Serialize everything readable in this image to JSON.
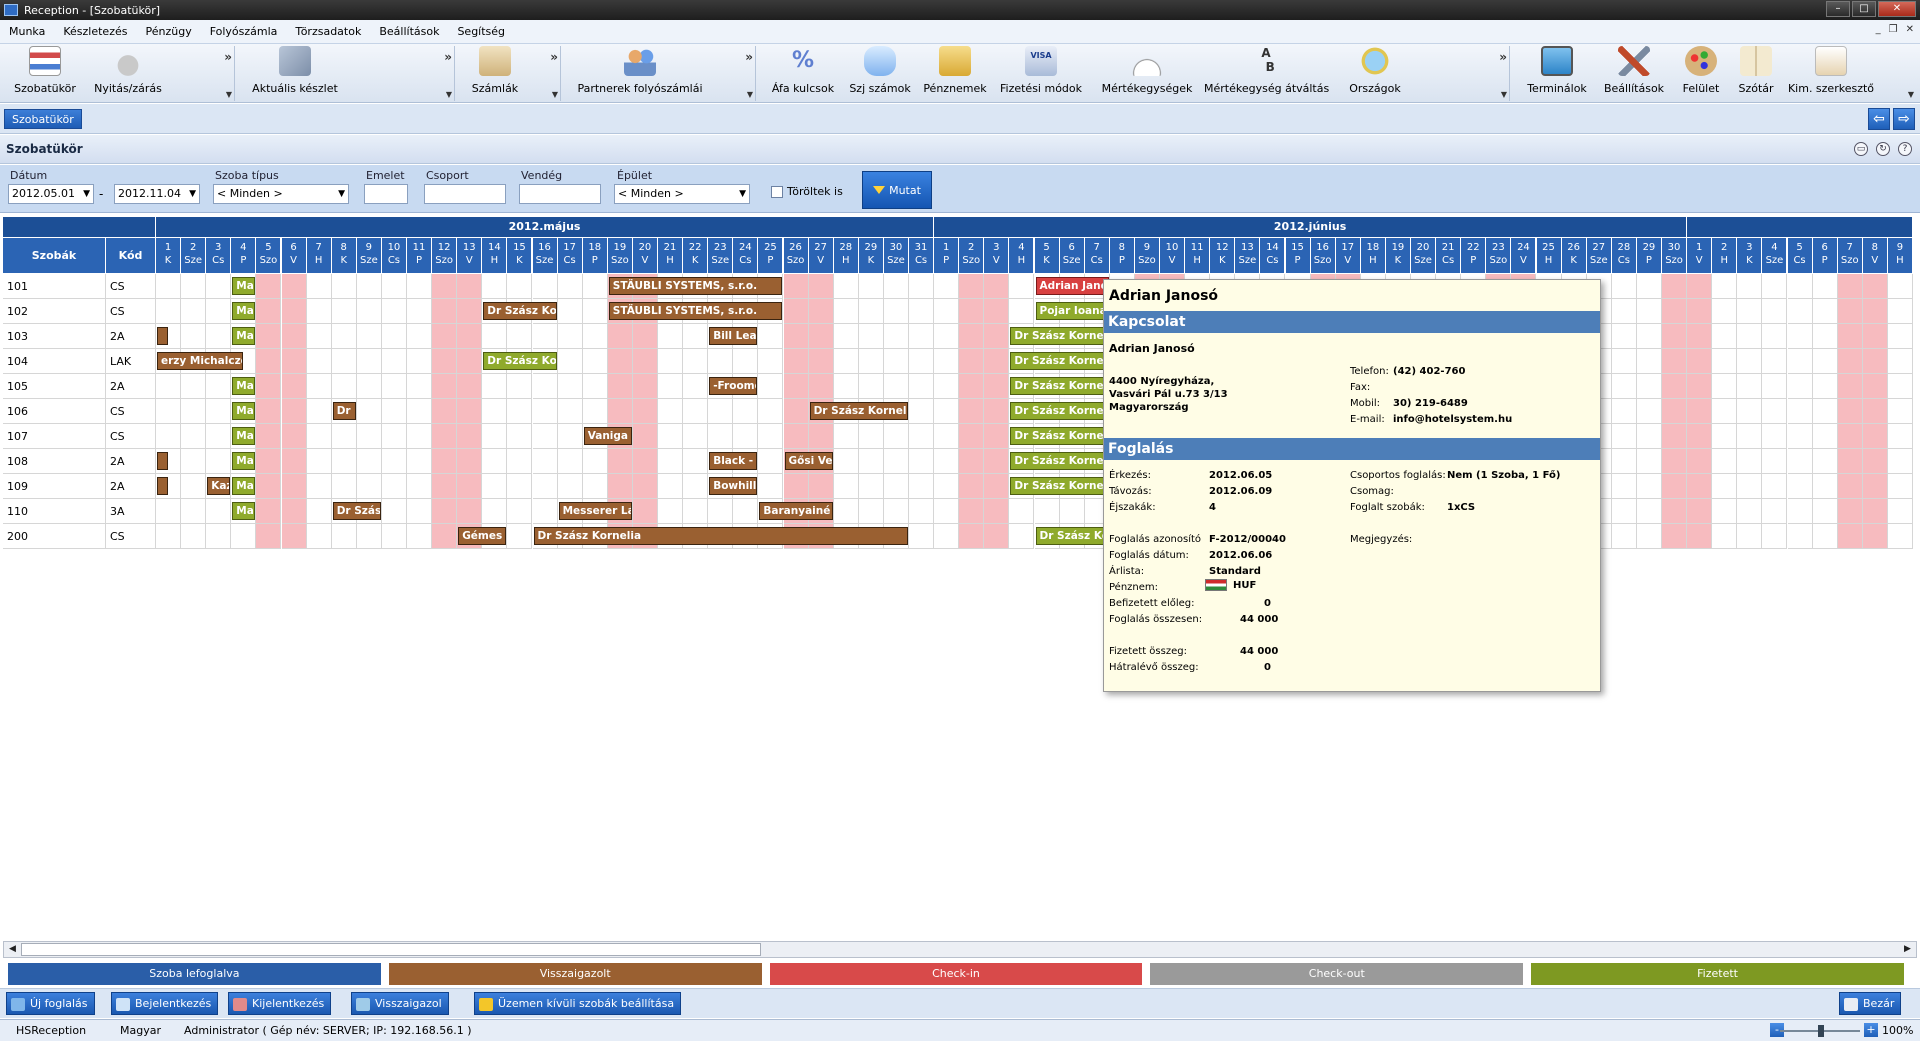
{
  "window": {
    "title": "Reception - [Szobatükör]"
  },
  "menu": [
    "Munka",
    "Készletezés",
    "Pénzügy",
    "Folyószámla",
    "Törzsadatok",
    "Beállítások",
    "Segítség"
  ],
  "toolbar": {
    "buttons": [
      {
        "label": "Szobatükör",
        "icon": "room-mirror-icon"
      },
      {
        "label": "Nyitás/zárás",
        "icon": "padlock-icon"
      },
      {
        "label": "Aktuális készlet",
        "icon": "stock-icon"
      },
      {
        "label": "Számlák",
        "icon": "invoice-icon"
      },
      {
        "label": "Partnerek folyószámlái",
        "icon": "partners-icon"
      },
      {
        "label": "Áfa kulcsok",
        "icon": "percent-icon"
      },
      {
        "label": "Szj számok",
        "icon": "database-icon"
      },
      {
        "label": "Pénznemek",
        "icon": "currency-icon"
      },
      {
        "label": "Fizetési módok",
        "icon": "card-icon"
      },
      {
        "label": "Mértékegységek",
        "icon": "gauge-icon"
      },
      {
        "label": "Mértékegység átváltás",
        "icon": "conversion-icon"
      },
      {
        "label": "Országok",
        "icon": "globe-icon"
      },
      {
        "label": "Terminálok",
        "icon": "monitor-icon"
      },
      {
        "label": "Beállítások",
        "icon": "tools-icon"
      },
      {
        "label": "Felület",
        "icon": "palette-icon"
      },
      {
        "label": "Szótár",
        "icon": "book-icon"
      },
      {
        "label": "Kim. szerkesztő",
        "icon": "editor-icon"
      }
    ]
  },
  "tab": {
    "label": "Szobatükör"
  },
  "page": {
    "title": "Szobatükör"
  },
  "filters": {
    "date_label": "Dátum",
    "date_from": "2012.05.01",
    "date_sep": "-",
    "date_to": "2012.11.04",
    "room_type_label": "Szoba típus",
    "room_type_value": "< Minden >",
    "floor_label": "Emelet",
    "floor_value": "",
    "group_label": "Csoport",
    "group_value": "",
    "guest_label": "Vendég",
    "guest_value": "",
    "building_label": "Épület",
    "building_value": "< Minden >",
    "deleted_label": "Töröltek is",
    "show_label": "Mutat"
  },
  "grid": {
    "col_rooms": "Szobák",
    "col_code": "Kód",
    "months": [
      {
        "label": "2012.május"
      },
      {
        "label": "2012.június"
      },
      {
        "label": ""
      }
    ],
    "days": [
      [
        "1",
        "K"
      ],
      [
        "2",
        "Sze"
      ],
      [
        "3",
        "Cs"
      ],
      [
        "4",
        "P"
      ],
      [
        "5",
        "Szo"
      ],
      [
        "6",
        "V"
      ],
      [
        "7",
        "H"
      ],
      [
        "8",
        "K"
      ],
      [
        "9",
        "Sze"
      ],
      [
        "10",
        "Cs"
      ],
      [
        "11",
        "P"
      ],
      [
        "12",
        "Szo"
      ],
      [
        "13",
        "V"
      ],
      [
        "14",
        "H"
      ],
      [
        "15",
        "K"
      ],
      [
        "16",
        "Sze"
      ],
      [
        "17",
        "Cs"
      ],
      [
        "18",
        "P"
      ],
      [
        "19",
        "Szo"
      ],
      [
        "20",
        "V"
      ],
      [
        "21",
        "H"
      ],
      [
        "22",
        "K"
      ],
      [
        "23",
        "Sze"
      ],
      [
        "24",
        "Cs"
      ],
      [
        "25",
        "P"
      ],
      [
        "26",
        "Szo"
      ],
      [
        "27",
        "V"
      ],
      [
        "28",
        "H"
      ],
      [
        "29",
        "K"
      ],
      [
        "30",
        "Sze"
      ],
      [
        "31",
        "Cs"
      ],
      [
        "1",
        "P"
      ],
      [
        "2",
        "Szo"
      ],
      [
        "3",
        "V"
      ],
      [
        "4",
        "H"
      ],
      [
        "5",
        "K"
      ],
      [
        "6",
        "Sze"
      ],
      [
        "7",
        "Cs"
      ],
      [
        "8",
        "P"
      ],
      [
        "9",
        "Szo"
      ],
      [
        "10",
        "V"
      ],
      [
        "11",
        "H"
      ],
      [
        "12",
        "K"
      ],
      [
        "13",
        "Sze"
      ],
      [
        "14",
        "Cs"
      ],
      [
        "15",
        "P"
      ],
      [
        "16",
        "Szo"
      ],
      [
        "17",
        "V"
      ],
      [
        "18",
        "H"
      ],
      [
        "19",
        "K"
      ],
      [
        "20",
        "Sze"
      ],
      [
        "21",
        "Cs"
      ],
      [
        "22",
        "P"
      ],
      [
        "23",
        "Szo"
      ],
      [
        "24",
        "V"
      ],
      [
        "25",
        "H"
      ],
      [
        "26",
        "K"
      ],
      [
        "27",
        "Sze"
      ],
      [
        "28",
        "Cs"
      ],
      [
        "29",
        "P"
      ],
      [
        "30",
        "Szo"
      ],
      [
        "1",
        "V"
      ],
      [
        "2",
        "H"
      ],
      [
        "3",
        "K"
      ],
      [
        "4",
        "Sze"
      ],
      [
        "5",
        "Cs"
      ],
      [
        "6",
        "P"
      ],
      [
        "7",
        "Szo"
      ],
      [
        "8",
        "V"
      ],
      [
        "9",
        "H"
      ]
    ],
    "rooms": [
      {
        "room": "101",
        "code": "CS"
      },
      {
        "room": "102",
        "code": "CS"
      },
      {
        "room": "103",
        "code": "2A"
      },
      {
        "room": "104",
        "code": "LAK"
      },
      {
        "room": "105",
        "code": "2A"
      },
      {
        "room": "106",
        "code": "CS"
      },
      {
        "room": "107",
        "code": "CS"
      },
      {
        "room": "108",
        "code": "2A"
      },
      {
        "room": "109",
        "code": "2A"
      },
      {
        "room": "110",
        "code": "3A"
      },
      {
        "room": "200",
        "code": "CS"
      }
    ],
    "bookings": [
      {
        "row": 0,
        "start": 3,
        "end": 4,
        "text": "Ma",
        "status": "green"
      },
      {
        "row": 0,
        "start": 18,
        "end": 25,
        "text": "STÄUBLI SYSTEMS, s.r.o.",
        "status": "brown"
      },
      {
        "row": 0,
        "start": 35,
        "end": 38,
        "text": "Adrian Janosó",
        "status": "red"
      },
      {
        "row": 1,
        "start": 3,
        "end": 4,
        "text": "Ma",
        "status": "green"
      },
      {
        "row": 1,
        "start": 13,
        "end": 16,
        "text": "Dr Szász Kornelia",
        "status": "brown"
      },
      {
        "row": 1,
        "start": 18,
        "end": 25,
        "text": "STÄUBLI SYSTEMS, s.r.o.",
        "status": "brown"
      },
      {
        "row": 1,
        "start": 35,
        "end": 38,
        "text": "Pojar Ioana",
        "status": "green"
      },
      {
        "row": 2,
        "start": 0,
        "end": 0.5,
        "text": "",
        "status": "brown"
      },
      {
        "row": 2,
        "start": 3,
        "end": 4,
        "text": "Ma",
        "status": "green"
      },
      {
        "row": 2,
        "start": 22,
        "end": 24,
        "text": "Bill Lear",
        "status": "brown"
      },
      {
        "row": 2,
        "start": 34,
        "end": 38,
        "text": "Dr Szász Kornelia",
        "status": "green"
      },
      {
        "row": 3,
        "start": 0,
        "end": 3.5,
        "text": "erzy  Michalczewski",
        "status": "brown"
      },
      {
        "row": 3,
        "start": 13,
        "end": 16,
        "text": "Dr Szász Kornelia",
        "status": "green"
      },
      {
        "row": 3,
        "start": 34,
        "end": 38,
        "text": "Dr Szász Kornelia",
        "status": "green"
      },
      {
        "row": 4,
        "start": 3,
        "end": 4,
        "text": "Ma",
        "status": "green"
      },
      {
        "row": 4,
        "start": 22,
        "end": 24,
        "text": "-Froome",
        "status": "brown"
      },
      {
        "row": 4,
        "start": 34,
        "end": 38,
        "text": "Dr Szász Kornelia",
        "status": "green"
      },
      {
        "row": 5,
        "start": 3,
        "end": 4,
        "text": "Ma",
        "status": "green"
      },
      {
        "row": 5,
        "start": 7,
        "end": 8,
        "text": "Dr",
        "status": "brown"
      },
      {
        "row": 5,
        "start": 26,
        "end": 30,
        "text": "Dr Szász Kornelia",
        "status": "brown"
      },
      {
        "row": 5,
        "start": 34,
        "end": 38,
        "text": "Dr Szász Kornelia",
        "status": "green"
      },
      {
        "row": 6,
        "start": 3,
        "end": 4,
        "text": "Ma",
        "status": "green"
      },
      {
        "row": 6,
        "start": 17,
        "end": 19,
        "text": "Vaniga Z",
        "status": "brown"
      },
      {
        "row": 6,
        "start": 34,
        "end": 38,
        "text": "Dr Szász Kornelia",
        "status": "green"
      },
      {
        "row": 7,
        "start": 0,
        "end": 0.5,
        "text": "",
        "status": "brown"
      },
      {
        "row": 7,
        "start": 3,
        "end": 4,
        "text": "Ma",
        "status": "green"
      },
      {
        "row": 7,
        "start": 22,
        "end": 24,
        "text": "Black -",
        "status": "brown"
      },
      {
        "row": 7,
        "start": 25,
        "end": 27,
        "text": "Gősi  Ve",
        "status": "brown"
      },
      {
        "row": 7,
        "start": 34,
        "end": 38,
        "text": "Dr Szász Kornelia",
        "status": "green"
      },
      {
        "row": 8,
        "start": 0,
        "end": 0.5,
        "text": "",
        "status": "brown"
      },
      {
        "row": 8,
        "start": 2,
        "end": 3,
        "text": "Kaz",
        "status": "brown"
      },
      {
        "row": 8,
        "start": 3,
        "end": 4,
        "text": "Ma",
        "status": "green"
      },
      {
        "row": 8,
        "start": 22,
        "end": 24,
        "text": "Bowhill",
        "status": "brown"
      },
      {
        "row": 8,
        "start": 34,
        "end": 38,
        "text": "Dr Szász Kornelia",
        "status": "green"
      },
      {
        "row": 9,
        "start": 3,
        "end": 4,
        "text": "Ma",
        "status": "green"
      },
      {
        "row": 9,
        "start": 7,
        "end": 9,
        "text": "Dr Szász",
        "status": "brown"
      },
      {
        "row": 9,
        "start": 16,
        "end": 19,
        "text": "Messerer Lá",
        "status": "brown"
      },
      {
        "row": 9,
        "start": 24,
        "end": 27,
        "text": "Baranyainé Móré",
        "status": "brown"
      },
      {
        "row": 10,
        "start": 12,
        "end": 14,
        "text": "Gémes",
        "status": "brown"
      },
      {
        "row": 10,
        "start": 15,
        "end": 30,
        "text": "Dr Szász Kornelia",
        "status": "brown"
      },
      {
        "row": 10,
        "start": 35,
        "end": 38,
        "text": "Dr Szász Kornelia",
        "status": "green"
      }
    ]
  },
  "tooltip": {
    "name": "Adrian Janosó",
    "contact_section": "Kapcsolat",
    "contact_name": "Adrian Janosó",
    "address_line1": "4400 Nyíregyháza,",
    "address_line2": "Vasvári Pál u.73 3/13",
    "address_line3": "Magyarország",
    "phone_label": "Telefon:",
    "phone": "(42) 402-760",
    "fax_label": "Fax:",
    "mobile_label": "Mobil:",
    "mobile": "30) 219-6489",
    "email_label": "E-mail:",
    "email": "info@hotelsystem.hu",
    "booking_section": "Foglalás",
    "arrival_label": "Érkezés:",
    "arrival": "2012.06.05",
    "departure_label": "Távozás:",
    "departure": "2012.06.09",
    "nights_label": "Éjszakák:",
    "nights": "4",
    "group_label": "Csoportos foglalás:",
    "group": "Nem (1 Szoba, 1 Fő)",
    "package_label": "Csomag:",
    "rooms_label": "Foglalt szobák:",
    "rooms": "1xCS",
    "id_label": "Foglalás azonosító",
    "id": "F-2012/00040",
    "date_label": "Foglalás dátum:",
    "date": "2012.06.06",
    "pricelist_label": "Árlista:",
    "pricelist": "Standard",
    "currency_label": "Pénznem:",
    "currency": "HUF",
    "advance_label": "Befizetett előleg:",
    "advance": "0",
    "total_label": "Foglalás összesen:",
    "total": "44 000",
    "paid_label": "Fizetett összeg:",
    "paid": "44 000",
    "remaining_label": "Hátralévő összeg:",
    "remaining": "0",
    "note_label": "Megjegyzés:"
  },
  "legend": [
    {
      "label": "Szoba lefoglalva",
      "color": "#2a5ea8"
    },
    {
      "label": "Visszaigazolt",
      "color": "#9a6031"
    },
    {
      "label": "Check-in",
      "color": "#d84a4a"
    },
    {
      "label": "Check-out",
      "color": "#9a9a9a"
    },
    {
      "label": "Fizetett",
      "color": "#7e9922"
    }
  ],
  "actions": {
    "new_booking": "Új foglalás",
    "checkin": "Bejelentkezés",
    "checkout": "Kijelentkezés",
    "confirm": "Visszaigazol",
    "out_of_order": "Üzemen kívüli szobák beállítása",
    "close": "Bezár"
  },
  "status": {
    "app": "HSReception",
    "language": "Magyar",
    "user": "Administrator ( Gép név: SERVER; IP: 192.168.56.1 )",
    "zoom": "100%"
  },
  "colors": {
    "header_blue": "#2b64b4",
    "weekend_pink": "#f7bbbf",
    "booking_brown": "#9a6031",
    "booking_green": "#8faa2c",
    "booking_red": "#d84040"
  }
}
